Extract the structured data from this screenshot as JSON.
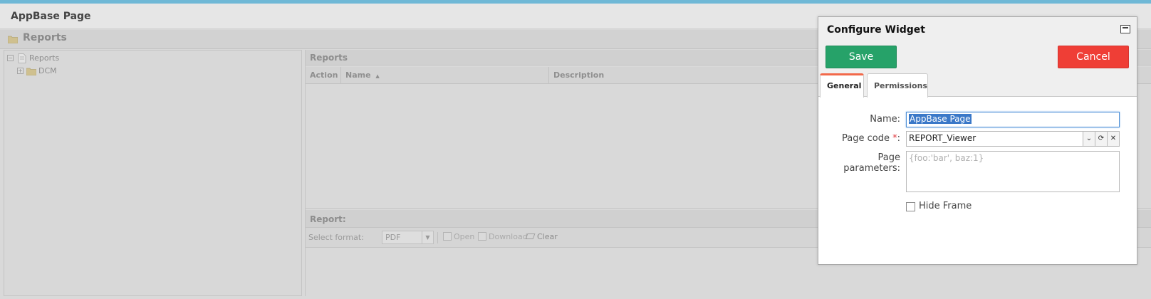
{
  "app": {
    "title": "AppBase Page"
  },
  "panel": {
    "title": "Reports"
  },
  "tree": {
    "root": {
      "label": "Reports",
      "toggle": "−"
    },
    "children": [
      {
        "label": "DCM",
        "toggle": "+"
      }
    ]
  },
  "reports": {
    "section_title": "Reports",
    "columns": [
      "Action",
      "Name",
      "Description"
    ],
    "sort_indicator": "▲"
  },
  "report": {
    "section_title": "Report:",
    "select_format_label": "Select format:",
    "format_value": "PDF",
    "open_label": "Open",
    "download_label": "Download",
    "clear_label": "Clear"
  },
  "dialog": {
    "title": "Configure Widget",
    "save_label": "Save",
    "cancel_label": "Cancel",
    "tabs": [
      "General",
      "Permissions"
    ],
    "active_tab": "General",
    "fields": {
      "name_label": "Name:",
      "name_value": "AppBase Page",
      "page_code_label": "Page code ",
      "required_marker": "*",
      "colon": ":",
      "page_code_value": "REPORT_Viewer",
      "page_params_label_line1": "Page",
      "page_params_label_line2": "parameters:",
      "page_params_placeholder": "{foo:'bar', baz:1}",
      "hide_frame_label": "Hide Frame",
      "hide_frame_checked": false
    }
  },
  "colors": {
    "save": "#26a269",
    "cancel": "#ef3e36",
    "active_tab_accent": "#f2694a",
    "top_accent": "#6fb8d6"
  }
}
